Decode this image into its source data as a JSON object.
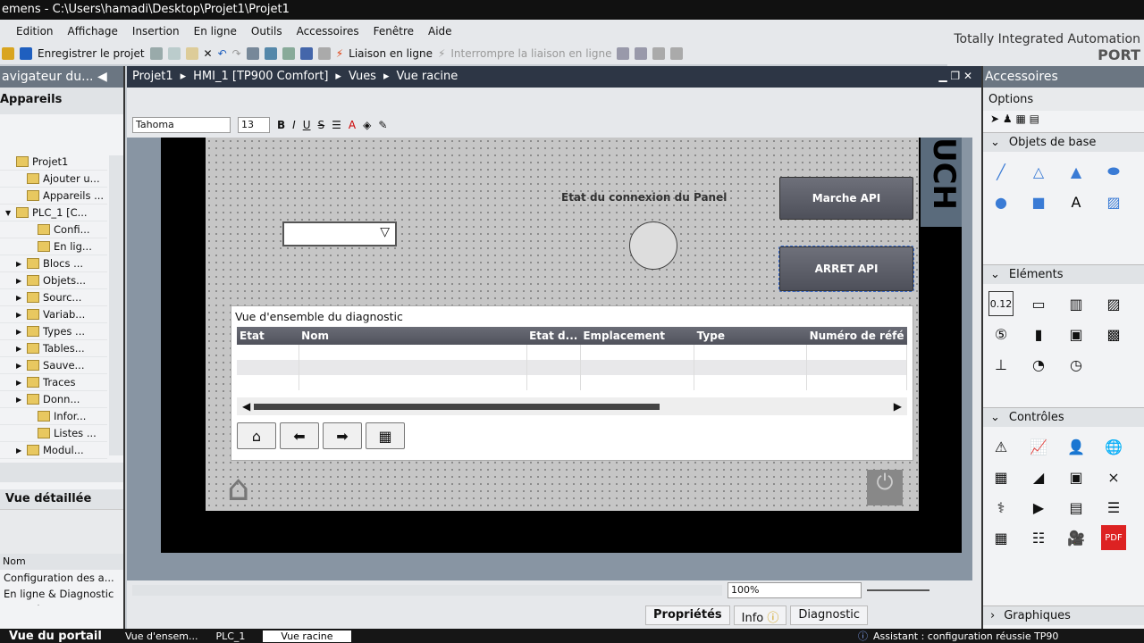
{
  "window": {
    "title": "emens - C:\\Users\\hamadi\\Desktop\\Projet1\\Projet1"
  },
  "menu": [
    "Edition",
    "Affichage",
    "Insertion",
    "En ligne",
    "Outils",
    "Accessoires",
    "Fenêtre",
    "Aide"
  ],
  "toolbar": {
    "save": "Enregistrer le projet",
    "online": "Liaison en ligne",
    "offline": "Interrompre la liaison en ligne"
  },
  "brand": {
    "line1": "Totally Integrated Automation",
    "line2": "PORT"
  },
  "left": {
    "header": "avigateur du...",
    "devices": "Appareils",
    "tree": [
      {
        "label": "Projet1",
        "level": 0,
        "arrow": ""
      },
      {
        "label": "Ajouter u...",
        "level": 1,
        "arrow": ""
      },
      {
        "label": "Appareils ...",
        "level": 1,
        "arrow": ""
      },
      {
        "label": "PLC_1 [C...",
        "level": 0,
        "arrow": "▼"
      },
      {
        "label": "Confi...",
        "level": 2,
        "arrow": ""
      },
      {
        "label": "En lig...",
        "level": 2,
        "arrow": ""
      },
      {
        "label": "Blocs ...",
        "level": 1,
        "arrow": "▶"
      },
      {
        "label": "Objets...",
        "level": 1,
        "arrow": "▶"
      },
      {
        "label": "Sourc...",
        "level": 1,
        "arrow": "▶"
      },
      {
        "label": "Variab...",
        "level": 1,
        "arrow": "▶"
      },
      {
        "label": "Types ...",
        "level": 1,
        "arrow": "▶"
      },
      {
        "label": "Tables...",
        "level": 1,
        "arrow": "▶"
      },
      {
        "label": "Sauve...",
        "level": 1,
        "arrow": "▶"
      },
      {
        "label": "Traces",
        "level": 1,
        "arrow": "▶"
      },
      {
        "label": "Donn...",
        "level": 1,
        "arrow": "▶"
      },
      {
        "label": "Infor...",
        "level": 2,
        "arrow": ""
      },
      {
        "label": "Listes ...",
        "level": 2,
        "arrow": ""
      },
      {
        "label": "Modul...",
        "level": 1,
        "arrow": "▶"
      }
    ],
    "detail_title": "Vue détaillée",
    "detail_col": "Nom",
    "detail_items": [
      "Configuration des a...",
      "En ligne & Diagnostic",
      "Paramètres Runtime"
    ]
  },
  "breadcrumb": [
    "Projet1",
    "HMI_1 [TP900 Comfort]",
    "Vues",
    "Vue racine"
  ],
  "fontbar": {
    "font": "Tahoma",
    "size": "13"
  },
  "hmi": {
    "status_label": "Etat du connexion du Panel",
    "btn_start": "Marche API",
    "btn_stop": "ARRET API",
    "side_text": "UCH",
    "diag_title": "Vue d'ensemble du diagnostic",
    "diag_columns": [
      "Etat",
      "Nom",
      "Etat d...",
      "Emplacement",
      "Type",
      "Numéro de réfé"
    ]
  },
  "zoom": {
    "value": "100%"
  },
  "tabs": {
    "props": "Propriétés",
    "info": "Info",
    "diag": "Diagnostic"
  },
  "right": {
    "header": "Accessoires",
    "options": "Options",
    "sections": {
      "basic": "Objets de base",
      "elements": "Eléments",
      "controls": "Contrôles",
      "graphics": "Graphiques"
    },
    "element_text": "0.12",
    "pdf": "PDF"
  },
  "taskbar": {
    "portal": "Vue du portail",
    "items": [
      "Vue d'ensem...",
      "PLC_1",
      "Vue racine"
    ],
    "status": "Assistant : configuration réussie TP90"
  }
}
